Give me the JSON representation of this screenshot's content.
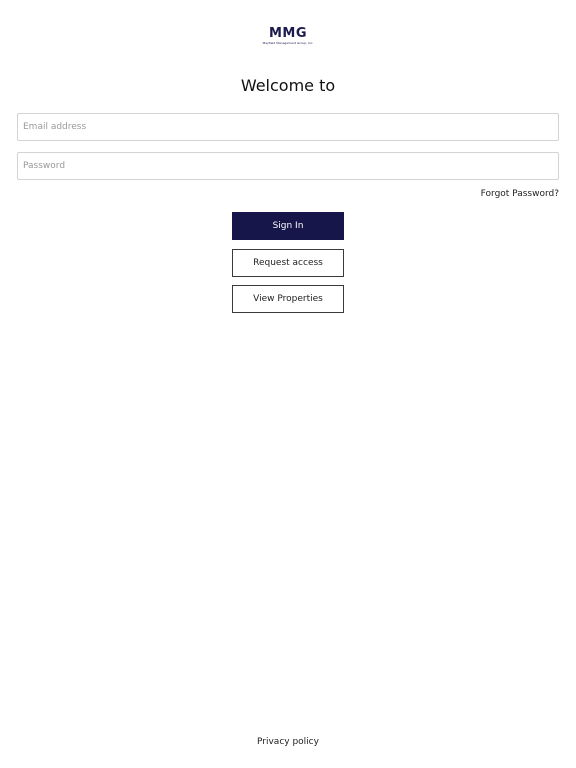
{
  "logo": {
    "mark": "MMG",
    "tagline": "Mayfield Management Group, Inc."
  },
  "heading": "Welcome to",
  "form": {
    "email_placeholder": "Email address",
    "email_value": "",
    "password_placeholder": "Password",
    "password_value": "",
    "forgot_label": "Forgot Password?"
  },
  "buttons": {
    "sign_in": "Sign In",
    "request_access": "Request access",
    "view_properties": "View Properties"
  },
  "footer": {
    "privacy_label": "Privacy policy"
  },
  "colors": {
    "primary": "#16164a",
    "brand": "#1a1a4e"
  }
}
